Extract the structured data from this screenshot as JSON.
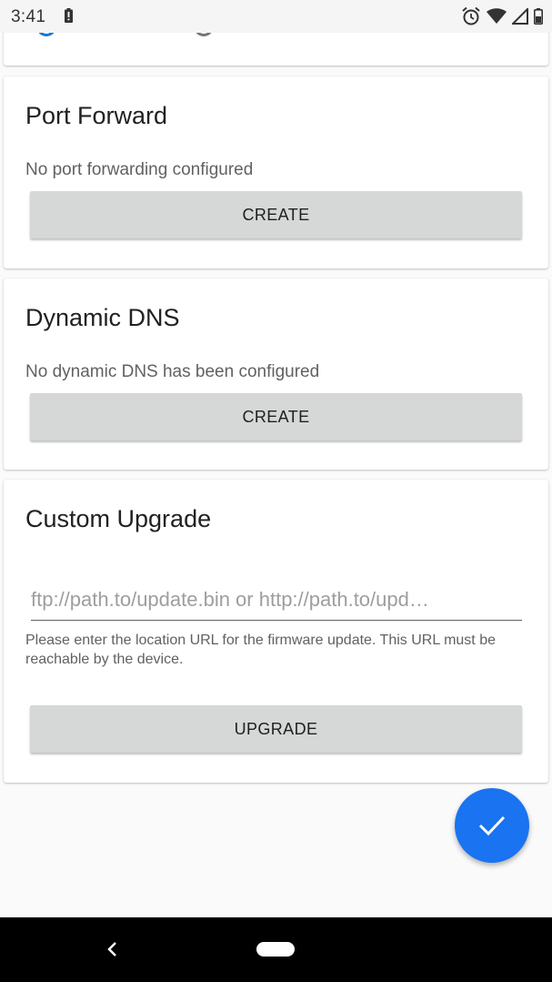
{
  "status_bar": {
    "time": "3:41",
    "icons": [
      "battery-alert-icon",
      "alarm-icon",
      "wifi-icon",
      "cell-signal-icon",
      "battery-icon"
    ]
  },
  "port_forward": {
    "title": "Port Forward",
    "description": "No port forwarding configured",
    "button_label": "CREATE"
  },
  "dynamic_dns": {
    "title": "Dynamic DNS",
    "description": "No dynamic DNS has been configured",
    "button_label": "CREATE"
  },
  "custom_upgrade": {
    "title": "Custom Upgrade",
    "url_value": "",
    "url_placeholder": "ftp://path.to/update.bin or http://path.to/upd…",
    "helper_text": "Please enter the location URL for the firmware update. This URL must be reachable by the device.",
    "button_label": "UPGRADE"
  },
  "fab": {
    "icon": "check-icon"
  },
  "nav_bar": {
    "icons": [
      "back-icon",
      "home-pill-icon"
    ]
  },
  "colors": {
    "accent": "#1a73f0",
    "button_bg": "#d6d7d7",
    "status_bar_bg": "#f5f5f5"
  }
}
